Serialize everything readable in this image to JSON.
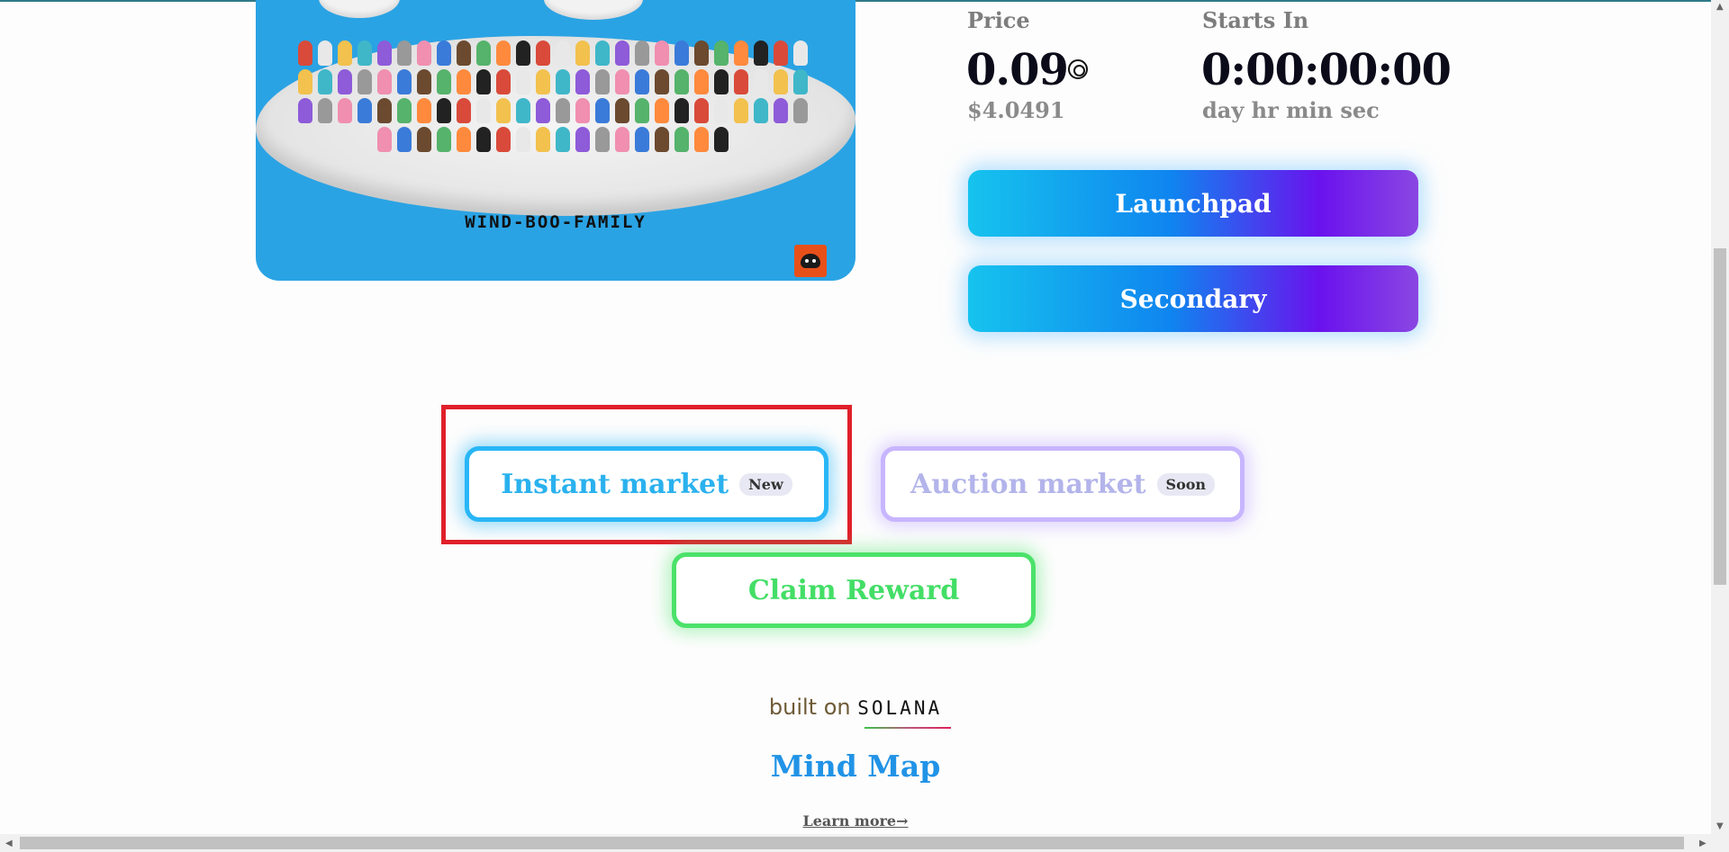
{
  "hero": {
    "caption": "WIND-BOO-FAMILY",
    "logo_icon": "boo-logo-icon"
  },
  "price": {
    "label": "Price",
    "value": "0.09",
    "usd": "$4.0491",
    "currency_icon": "solana-coin-icon"
  },
  "countdown": {
    "label": "Starts In",
    "value": "0:00:00:00",
    "units": "day hr min sec"
  },
  "buttons": {
    "launchpad": "Launchpad",
    "secondary": "Secondary"
  },
  "markets": {
    "instant": {
      "label": "Instant market",
      "badge": "New",
      "color": "#29b6f6"
    },
    "auction": {
      "label": "Auction market",
      "badge": "Soon",
      "color": "#c7b5ff"
    },
    "claim": {
      "label": "Claim Reward",
      "color": "#4be26a"
    }
  },
  "footer": {
    "built_on": "built on",
    "solana": "SOLANA",
    "mind_map": "Mind Map",
    "learn_more": "Learn more→"
  }
}
